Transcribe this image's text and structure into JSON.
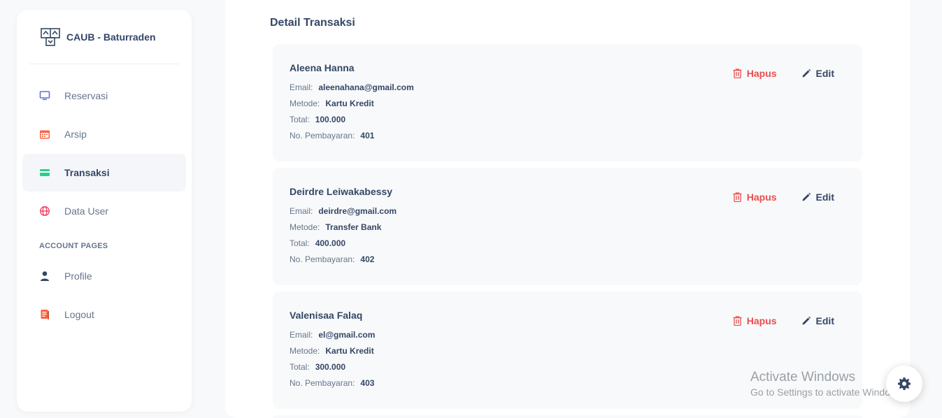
{
  "brand": {
    "name": "CAUB - Baturraden",
    "logo_icon": "building-logo-icon"
  },
  "sidebar": {
    "items": [
      {
        "label": "Reservasi",
        "icon": "monitor-icon",
        "color": "#5e72e4",
        "active": false
      },
      {
        "label": "Arsip",
        "icon": "calendar-icon",
        "color": "#fb6340",
        "active": false
      },
      {
        "label": "Transaksi",
        "icon": "credit-card-icon",
        "color": "#2dce89",
        "active": true
      },
      {
        "label": "Data User",
        "icon": "globe-icon",
        "color": "#f5365c",
        "active": false
      }
    ],
    "account_heading": "ACCOUNT PAGES",
    "account_items": [
      {
        "label": "Profile",
        "icon": "user-icon",
        "color": "#344767"
      },
      {
        "label": "Logout",
        "icon": "document-icon",
        "color": "#fb6340"
      }
    ]
  },
  "main": {
    "title": "Detail Transaksi",
    "field_labels": {
      "email": "Email:",
      "method": "Metode:",
      "total": "Total:",
      "payment_no": "No. Pembayaran:"
    },
    "delete_label": "Hapus",
    "edit_label": "Edit",
    "transactions": [
      {
        "name": "Aleena Hanna",
        "email": "aleenahana@gmail.com",
        "method": "Kartu Kredit",
        "total": "100.000",
        "payment_no": "401"
      },
      {
        "name": "Deirdre Leiwakabessy",
        "email": "deirdre@gmail.com",
        "method": "Transfer Bank",
        "total": "400.000",
        "payment_no": "402"
      },
      {
        "name": "Valenisaa Falaq",
        "email": "el@gmail.com",
        "method": "Kartu Kredit",
        "total": "300.000",
        "payment_no": "403"
      }
    ]
  },
  "watermark": {
    "title": "Activate Windows",
    "subtitle": "Go to Settings to activate Windows."
  },
  "colors": {
    "delete": "#ea4d4d",
    "text": "#344767",
    "muted": "#67748e"
  }
}
